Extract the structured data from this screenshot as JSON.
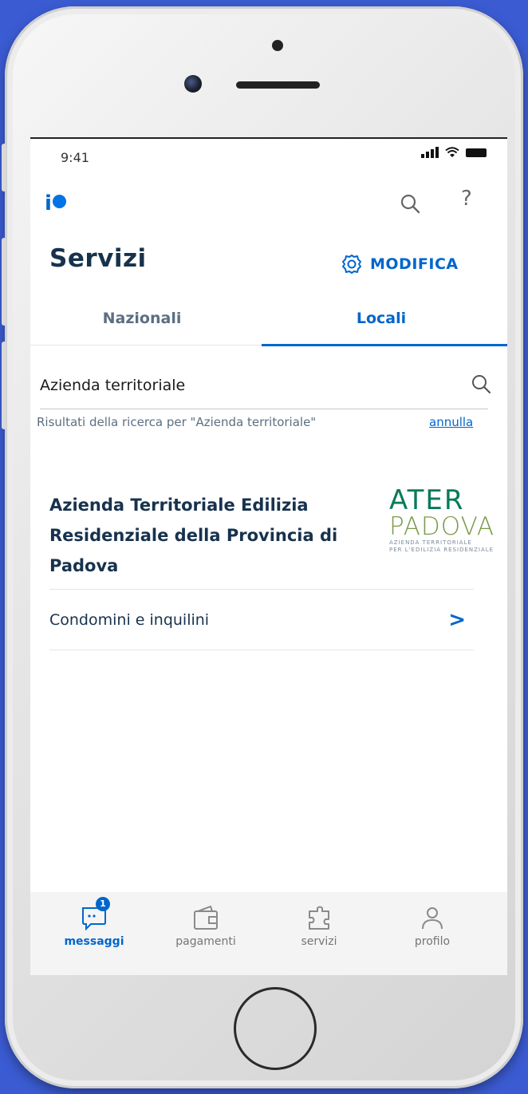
{
  "status_bar": {
    "time": "9:41"
  },
  "header": {
    "logo_text": "io"
  },
  "page": {
    "title": "Servizi",
    "modify_label": "MODIFICA"
  },
  "tabs": [
    {
      "label": "Nazionali",
      "active": false
    },
    {
      "label": "Locali",
      "active": true
    }
  ],
  "search": {
    "value": "Azienda territoriale",
    "results_text": "Risultati della ricerca per \"Azienda territoriale\"",
    "cancel_label": "annulla"
  },
  "organization": {
    "name": "Azienda Territoriale Edilizia Residenziale della Provincia di Padova",
    "logo": {
      "line1": "ATER",
      "line2": "PADOVA",
      "subline1": "AZIENDA TERRITORIALE",
      "subline2": "PER L'EDILIZIA RESIDENZIALE"
    },
    "services": [
      {
        "label": "Condomini e inquilini"
      }
    ]
  },
  "bottom_nav": [
    {
      "label": "messaggi",
      "icon": "message-icon",
      "active": true,
      "badge": "1"
    },
    {
      "label": "pagamenti",
      "icon": "wallet-icon",
      "active": false
    },
    {
      "label": "servizi",
      "icon": "services-icon",
      "active": false
    },
    {
      "label": "profilo",
      "icon": "profile-icon",
      "active": false
    }
  ],
  "colors": {
    "accent": "#0066cc",
    "title": "#17324d",
    "background": "#3b5bd2"
  }
}
